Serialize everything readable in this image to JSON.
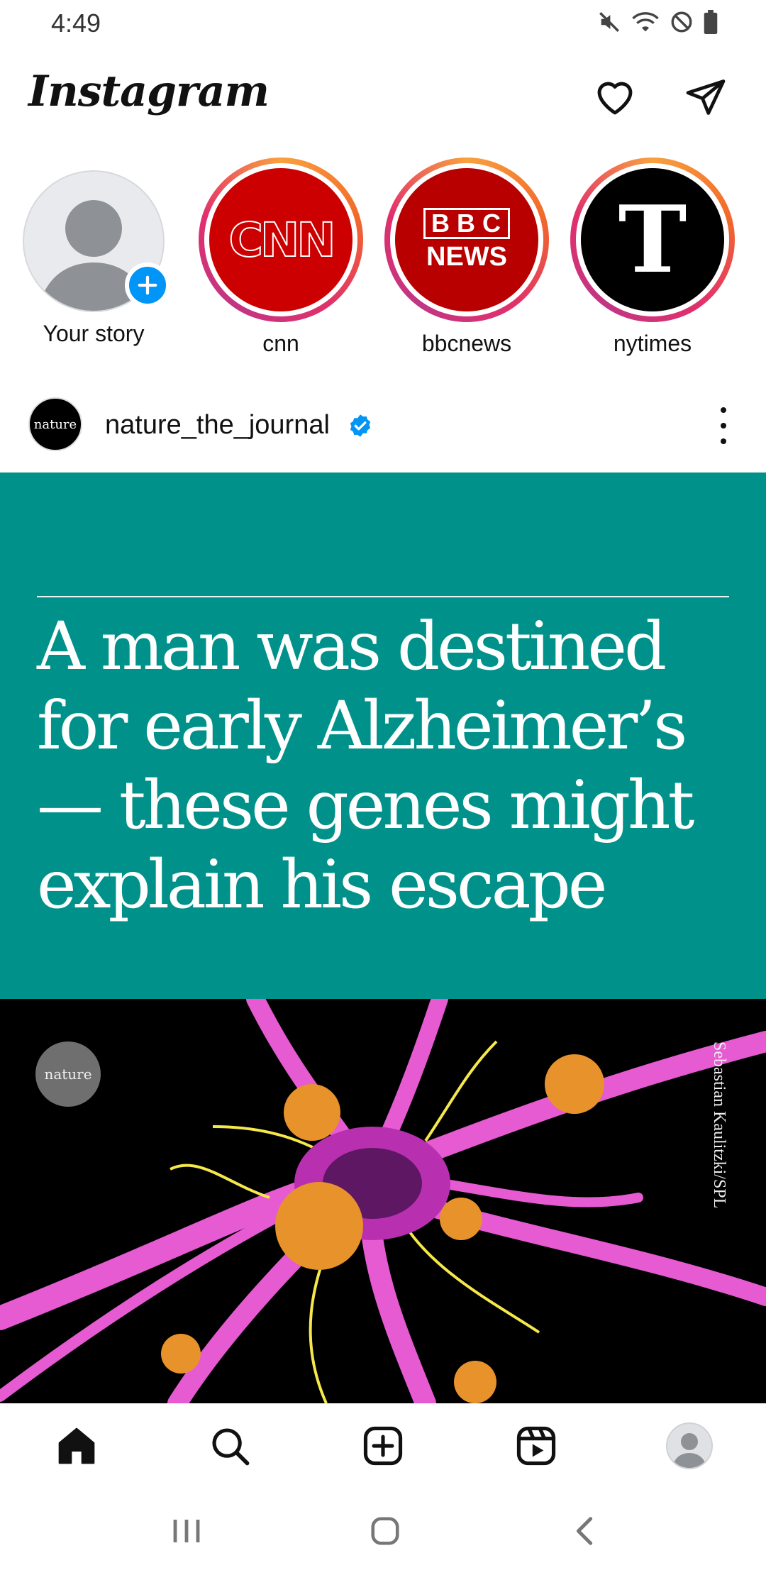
{
  "status": {
    "time": "4:49"
  },
  "header": {
    "logo": "Instagram"
  },
  "stories": [
    {
      "label": "Your story"
    },
    {
      "label": "cnn",
      "avatar_text": "CNN",
      "avatar_bg": "#cc0000"
    },
    {
      "label": "bbcnews",
      "avatar_top": "BBC",
      "avatar_bottom": "NEWS",
      "avatar_bg": "#b80000"
    },
    {
      "label": "nytimes",
      "avatar_text": "T",
      "avatar_bg": "#000000"
    }
  ],
  "post": {
    "username": "nature_the_journal",
    "avatar_text": "nature",
    "headline": "A man was destined for early Alzheimer’s — these genes might explain his escape",
    "badge_text": "nature",
    "credit": "Sebastian Kaulitzki/SPL",
    "colors": {
      "panel": "#00928a",
      "verified": "#0095f6"
    }
  }
}
